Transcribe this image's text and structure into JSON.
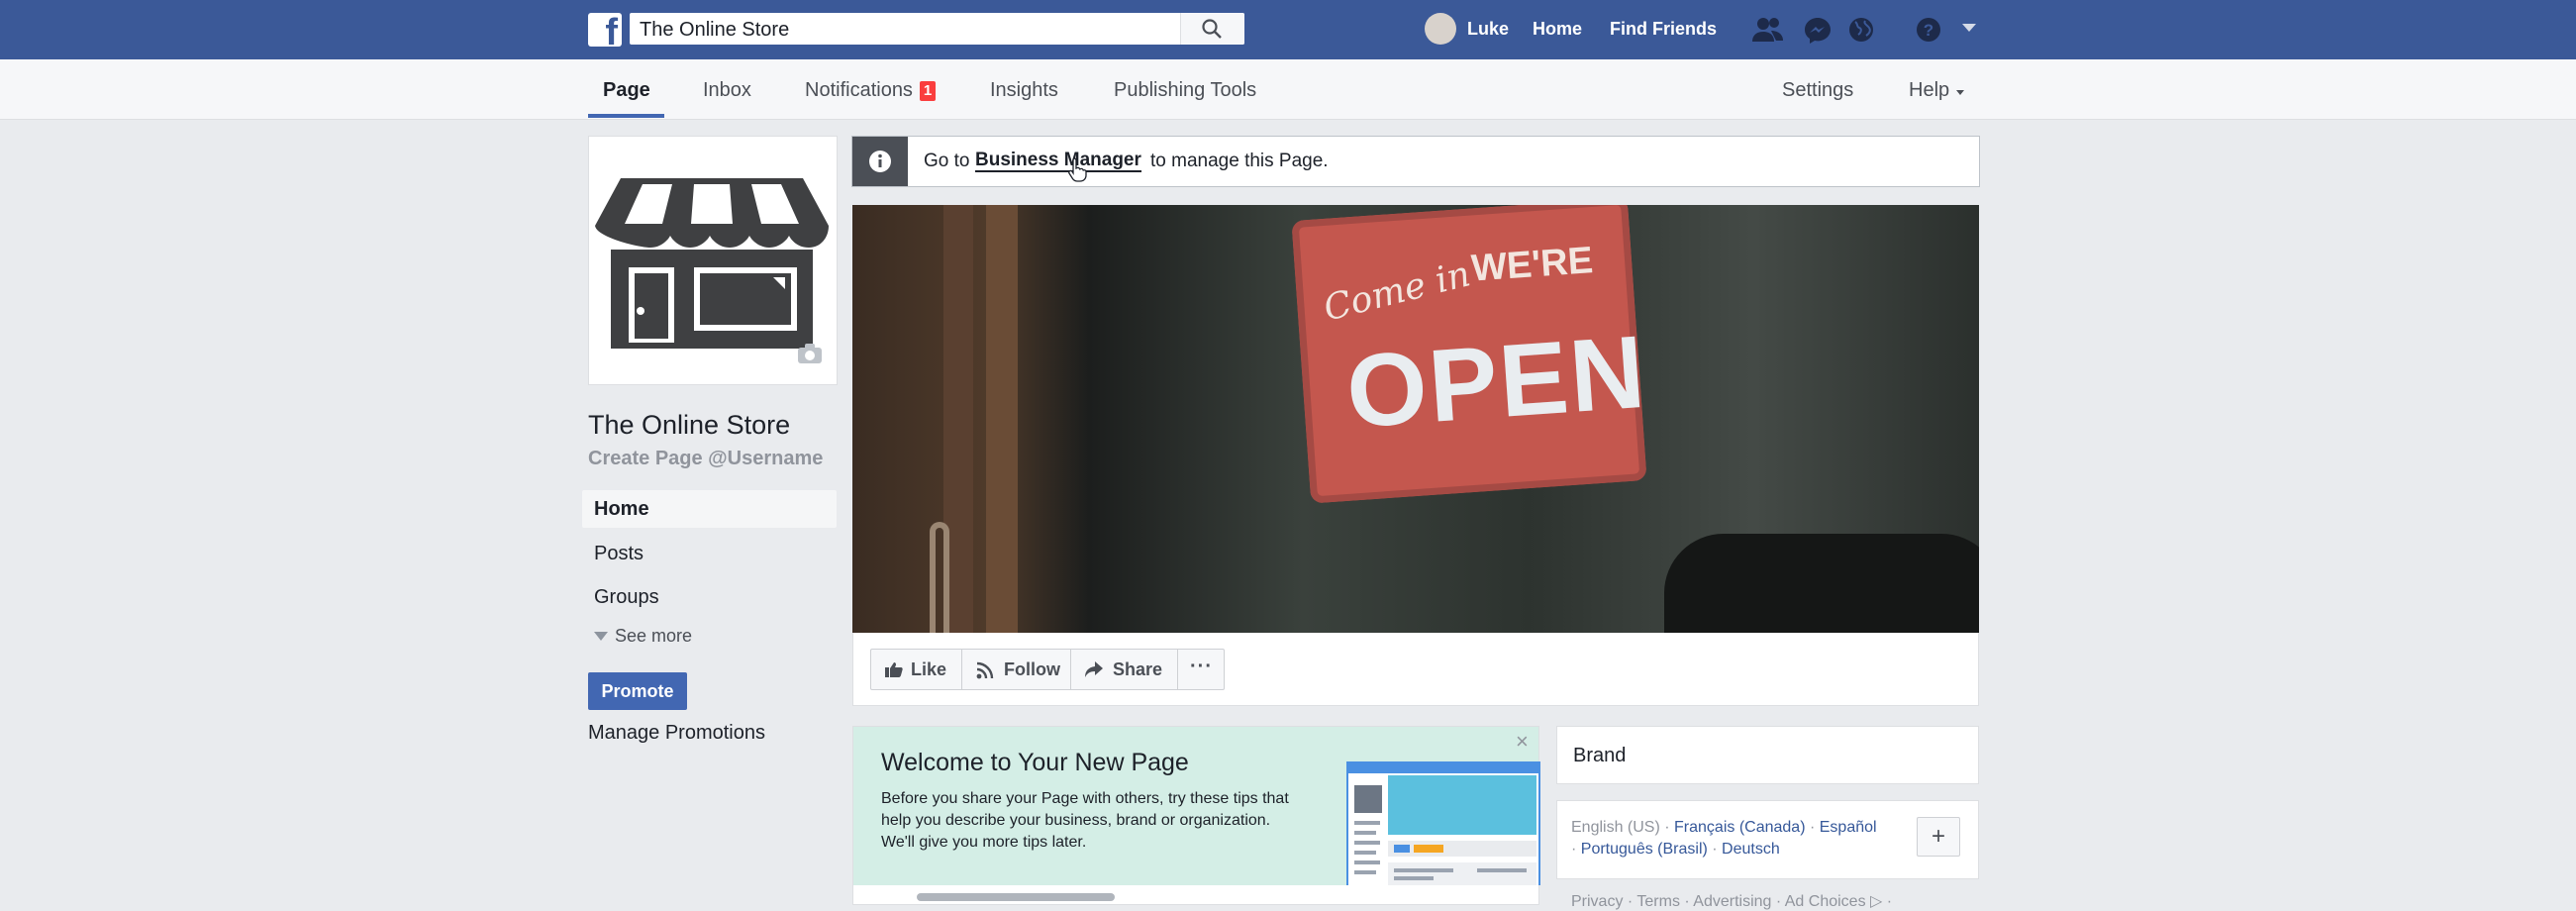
{
  "topbar": {
    "logo_letter": "f",
    "search_value": "The Online Store",
    "user_name": "Luke",
    "home_label": "Home",
    "find_friends_label": "Find Friends"
  },
  "page_nav": {
    "tabs": [
      "Page",
      "Inbox",
      "Notifications",
      "Insights",
      "Publishing Tools"
    ],
    "notifications_badge": "1",
    "settings_label": "Settings",
    "help_label": "Help"
  },
  "left": {
    "page_name": "The Online Store",
    "username_cta": "Create Page @Username",
    "nav": [
      "Home",
      "Posts",
      "Groups"
    ],
    "see_more": "See more",
    "promote_label": "Promote",
    "manage_promotions": "Manage Promotions"
  },
  "notice": {
    "prefix": "Go to",
    "link": "Business Manager",
    "suffix": "to manage this Page."
  },
  "cover": {
    "sign_script": "Come in",
    "sign_were": "WE'RE",
    "sign_open": "OPEN"
  },
  "actions": {
    "like": "Like",
    "follow": "Follow",
    "share": "Share",
    "more": "···"
  },
  "welcome": {
    "title": "Welcome to Your New Page",
    "description": "Before you share your Page with others, try these tips that help you describe your business, brand or organization. We'll give you more tips later.",
    "close": "×"
  },
  "right": {
    "brand": "Brand",
    "lang_current": "English (US) · ",
    "lang_fr": "Français (Canada)",
    "lang_sep1": " · ",
    "lang_es": "Español",
    "lang_sep2": "· ",
    "lang_pt": "Português (Brasil)",
    "lang_sep3": " · ",
    "lang_de": "Deutsch",
    "lang_add": "+",
    "footer": "Privacy · Terms · Advertising · Ad Choices ▷ ·"
  },
  "colors": {
    "topbar": "#3b5998",
    "accent": "#4267b2",
    "badge": "#fa3e3e",
    "welcome_bg": "#d4eee6"
  }
}
